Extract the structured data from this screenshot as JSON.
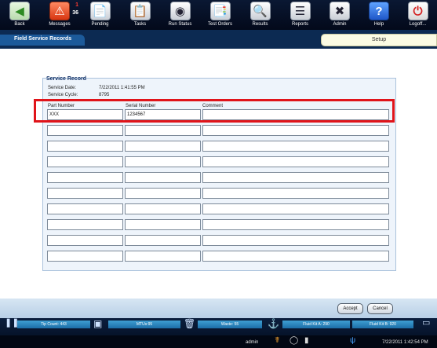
{
  "toolbar": {
    "back": "Back",
    "messages": "Messages",
    "messages_badge_top": "1",
    "messages_badge": "36",
    "pending": "Pending",
    "tasks": "Tasks",
    "run_status": "Run Status",
    "test_orders": "Test Orders",
    "results": "Results",
    "reports": "Reports",
    "admin": "Admin",
    "help": "Help",
    "logoff": "Logoff..."
  },
  "header": {
    "title": "Field Service Records",
    "tab_setup": "Setup"
  },
  "service_record": {
    "title": "Service Record",
    "service_date_label": "Service Date:",
    "service_date_value": "7/22/2011 1:41:55 PM",
    "service_cycle_label": "Service Cycle:",
    "service_cycle_value": "8795",
    "columns": {
      "part_number": "Part Number",
      "serial_number": "Serial Number",
      "comment": "Comment"
    },
    "rows": [
      {
        "part": "XXX",
        "serial": "1234567",
        "comment": ""
      },
      {
        "part": "",
        "serial": "",
        "comment": ""
      },
      {
        "part": "",
        "serial": "",
        "comment": ""
      },
      {
        "part": "",
        "serial": "",
        "comment": ""
      },
      {
        "part": "",
        "serial": "",
        "comment": ""
      },
      {
        "part": "",
        "serial": "",
        "comment": ""
      },
      {
        "part": "",
        "serial": "",
        "comment": ""
      },
      {
        "part": "",
        "serial": "",
        "comment": ""
      },
      {
        "part": "",
        "serial": "",
        "comment": ""
      },
      {
        "part": "",
        "serial": "",
        "comment": ""
      }
    ]
  },
  "actions": {
    "accept": "Accept",
    "cancel": "Cancel"
  },
  "status": {
    "tip_count": "Tip Count: 443",
    "mtus": "MTUs:95",
    "waste": "Waste: 55",
    "fluid_kit_a": "Fluid Kit A: 290",
    "fluid_kit_b": "Fluid Kit B: 920"
  },
  "tray": {
    "user": "admin",
    "datetime": "7/22/2011 1:42:54 PM"
  },
  "colors": {
    "highlight": "#e0141a",
    "toolbar_bg": "#0a1833",
    "status_segment": "#3e9fd2"
  }
}
